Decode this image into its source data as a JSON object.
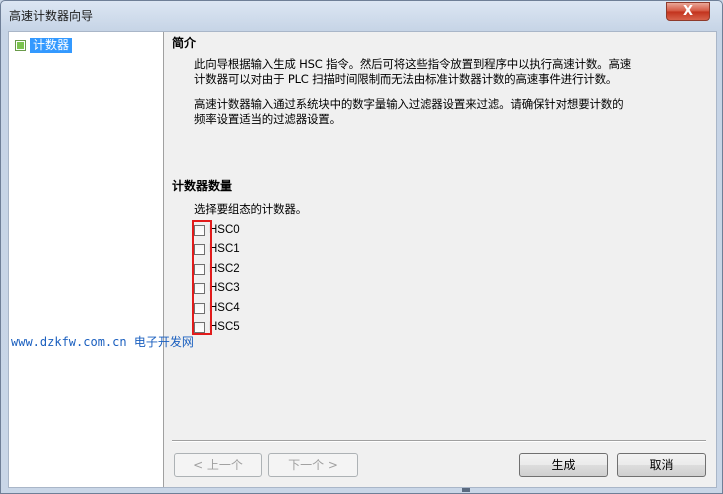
{
  "window": {
    "title": "高速计数器向导",
    "close_label": "X"
  },
  "nav": {
    "items": [
      {
        "label": "计数器",
        "selected": true
      }
    ]
  },
  "intro": {
    "heading": "简介",
    "para1_line1": "此向导根据输入生成 HSC 指令。然后可将这些指令放置到程序中以执行高速计数。高速",
    "para1_line2": "计数器可以对由于 PLC 扫描时间限制而无法由标准计数器计数的高速事件进行计数。",
    "para2_line1": "高速计数器输入通过系统块中的数字量输入过滤器设置来过滤。请确保针对想要计数的",
    "para2_line2": "频率设置适当的过滤器设置。"
  },
  "counters": {
    "heading": "计数器数量",
    "instruction": "选择要组态的计数器。",
    "items": [
      {
        "label": "HSC0",
        "checked": false
      },
      {
        "label": "HSC1",
        "checked": false
      },
      {
        "label": "HSC2",
        "checked": false
      },
      {
        "label": "HSC3",
        "checked": false
      },
      {
        "label": "HSC4",
        "checked": false
      },
      {
        "label": "HSC5",
        "checked": false
      }
    ]
  },
  "buttons": {
    "prev": "< 上一个",
    "next": "下一个 >",
    "generate": "生成",
    "cancel": "取消"
  },
  "watermark": {
    "url": "www.dzkfw.com.cn",
    "site": "电子开发网"
  },
  "colors": {
    "highlight": "#e11b1b",
    "selection": "#3399ff",
    "watermark": "#1a5fbf"
  }
}
